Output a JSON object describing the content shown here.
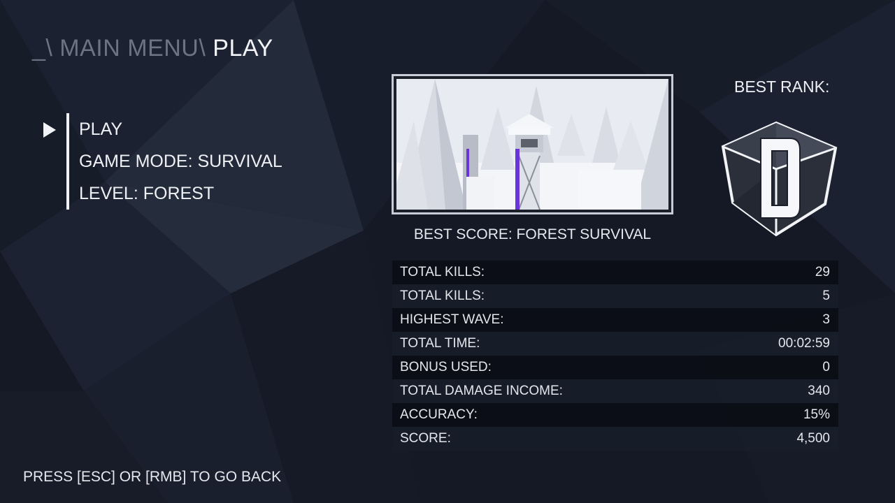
{
  "breadcrumb": {
    "prefix": "_\\ MAIN MENU\\",
    "current": "PLAY"
  },
  "menu": {
    "items": [
      {
        "label": "PLAY",
        "selected": true
      },
      {
        "label": "GAME MODE: SURVIVAL"
      },
      {
        "label": "LEVEL: FOREST"
      }
    ]
  },
  "preview": {
    "caption": "BEST SCORE: FOREST SURVIVAL"
  },
  "rank": {
    "label": "BEST RANK:",
    "value": "D"
  },
  "stats": [
    {
      "label": "TOTAL KILLS:",
      "value": "29"
    },
    {
      "label": "TOTAL KILLS:",
      "value": "5"
    },
    {
      "label": "HIGHEST WAVE:",
      "value": "3"
    },
    {
      "label": "TOTAL TIME:",
      "value": "00:02:59"
    },
    {
      "label": "BONUS USED:",
      "value": "0"
    },
    {
      "label": "TOTAL DAMAGE INCOME:",
      "value": "340"
    },
    {
      "label": "ACCURACY:",
      "value": "15%"
    },
    {
      "label": "SCORE:",
      "value": "4,500"
    }
  ],
  "footer": {
    "hint": "PRESS [ESC] OR [RMB] TO GO BACK"
  },
  "colors": {
    "background": "#141925",
    "text": "#eef0f4",
    "dim_text": "#6d7380",
    "accent_purple": "#6a35d8"
  }
}
